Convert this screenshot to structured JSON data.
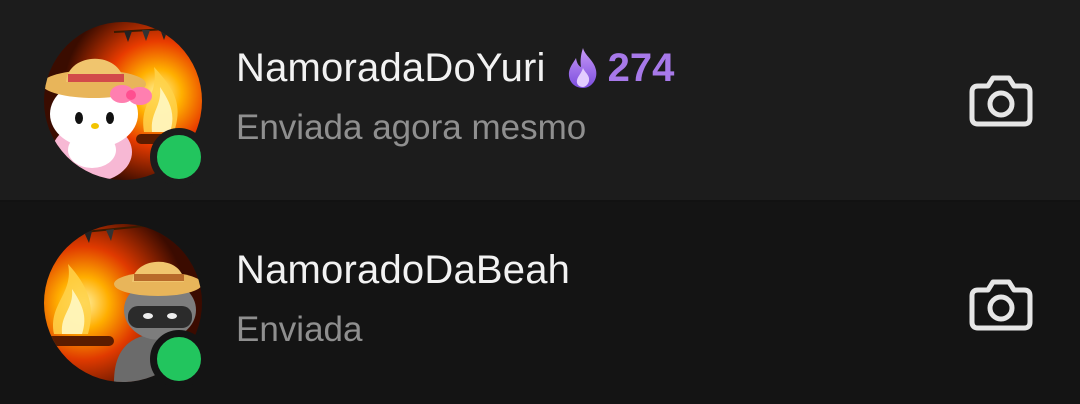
{
  "conversations": [
    {
      "name": "NamoradaDoYuri",
      "streak_count": "274",
      "status": "Enviada agora mesmo",
      "online": true,
      "avatar_icon": "hello-kitty-straw-hat-bonfire-avatar",
      "action_icon": "camera-icon"
    },
    {
      "name": "NamoradoDaBeah",
      "status": "Enviada",
      "online": true,
      "avatar_icon": "masked-character-straw-hat-bonfire-avatar",
      "action_icon": "camera-icon"
    }
  ],
  "colors": {
    "background": "#121212",
    "row_highlight": "#1c1c1c",
    "name_text": "#f2f2f2",
    "status_text": "#8f8f8f",
    "streak_purple": "#a779e9",
    "online_green": "#22c55e",
    "camera_icon": "#e6e6e6"
  }
}
